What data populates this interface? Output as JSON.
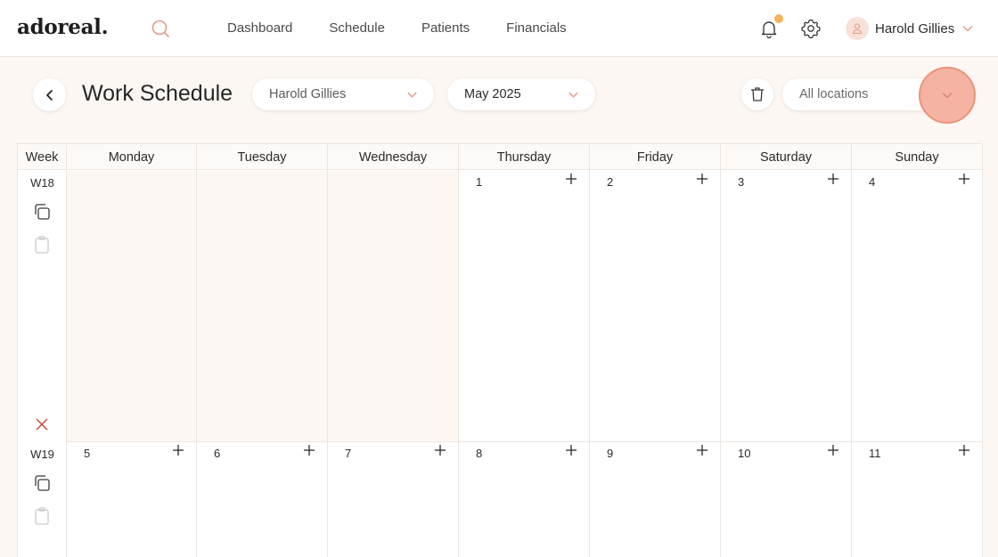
{
  "app": {
    "logo": "adoreal."
  },
  "nav": {
    "dashboard": "Dashboard",
    "schedule": "Schedule",
    "patients": "Patients",
    "financials": "Financials"
  },
  "user": {
    "name": "Harold Gillies"
  },
  "toolbar": {
    "title": "Work Schedule",
    "provider_value": "Harold Gillies",
    "month_value": "May 2025",
    "location_value": "All locations"
  },
  "calendar": {
    "week_header": "Week",
    "days": [
      "Monday",
      "Tuesday",
      "Wednesday",
      "Thursday",
      "Friday",
      "Saturday",
      "Sunday"
    ],
    "weeks": [
      {
        "label": "W18",
        "dates": [
          "",
          "",
          "",
          "1",
          "2",
          "3",
          "4"
        ]
      },
      {
        "label": "W19",
        "dates": [
          "5",
          "6",
          "7",
          "8",
          "9",
          "10",
          "11"
        ]
      }
    ]
  },
  "colors": {
    "accent": "#e49a82",
    "notification_dot": "#f2b35a",
    "background": "#fcf7f3",
    "remove_icon": "#c84a3f"
  }
}
